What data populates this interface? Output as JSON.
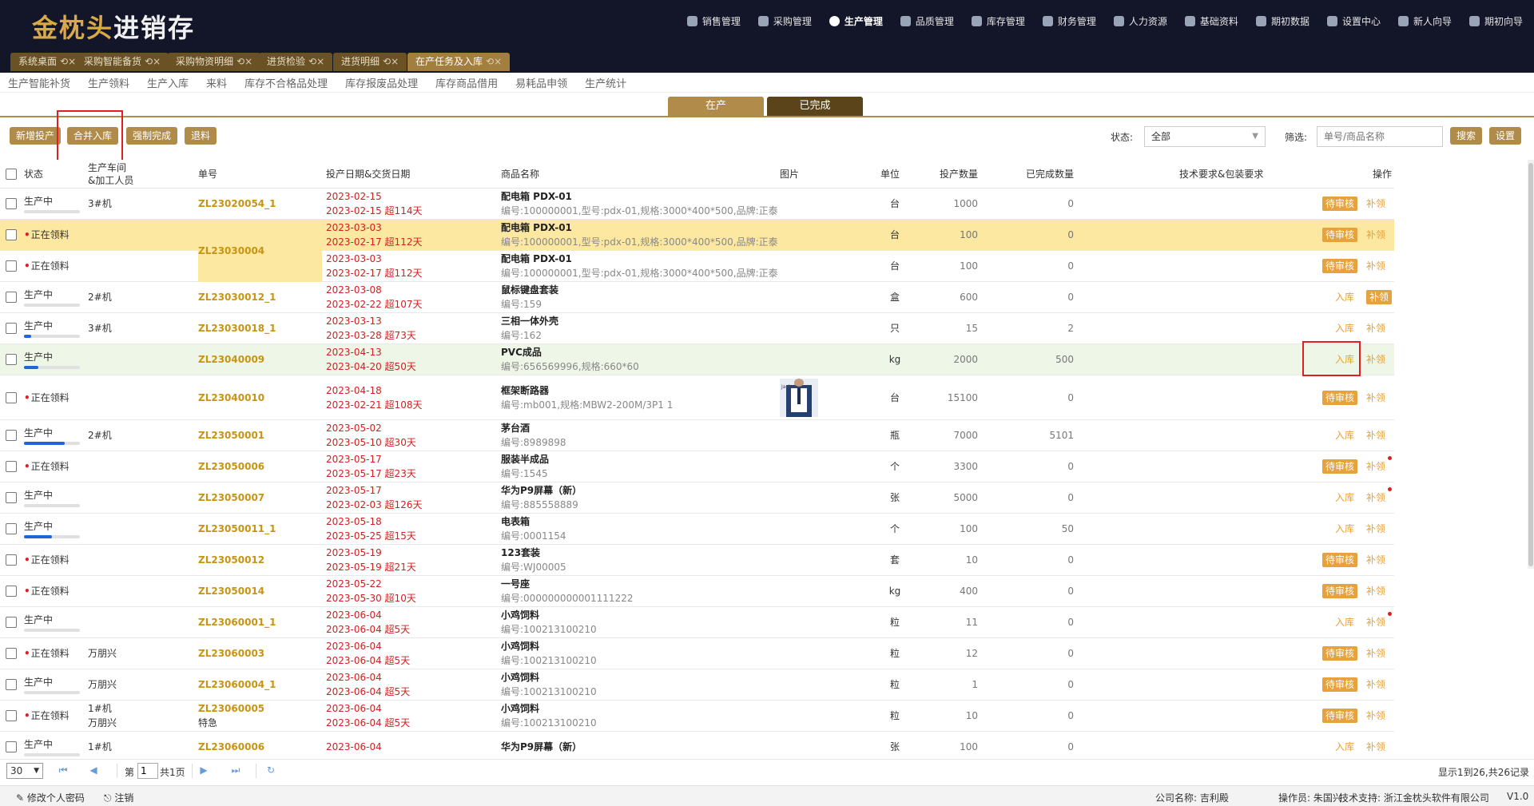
{
  "app": {
    "logo_a": "金枕头",
    "logo_b": "进销存"
  },
  "topnav": [
    {
      "label": "销售管理",
      "icon": "sales-icon"
    },
    {
      "label": "采购管理",
      "icon": "purchase-icon"
    },
    {
      "label": "生产管理",
      "icon": "production-icon"
    },
    {
      "label": "品质管理",
      "icon": "quality-icon"
    },
    {
      "label": "库存管理",
      "icon": "inventory-icon"
    },
    {
      "label": "财务管理",
      "icon": "finance-icon"
    },
    {
      "label": "人力资源",
      "icon": "hr-icon"
    },
    {
      "label": "基础资料",
      "icon": "basic-data-icon"
    },
    {
      "label": "期初数据",
      "icon": "opening-data-icon"
    },
    {
      "label": "设置中心",
      "icon": "settings-icon"
    },
    {
      "label": "新人向导",
      "icon": "newbie-guide-icon"
    },
    {
      "label": "期初向导",
      "icon": "opening-guide-icon"
    }
  ],
  "tabs": [
    {
      "label": "系统桌面"
    },
    {
      "label": "采购智能备货"
    },
    {
      "label": "采购物资明细"
    },
    {
      "label": "进货检验"
    },
    {
      "label": "进货明细"
    },
    {
      "label": "在产任务及入库"
    }
  ],
  "tab_close": "⟲×",
  "submenu": [
    "生产智能补货",
    "生产领料",
    "生产入库",
    "来料",
    "库存不合格品处理",
    "库存报废品处理",
    "库存商品借用",
    "易耗品申领",
    "生产统计"
  ],
  "segments": {
    "in_production": "在产",
    "completed": "已完成"
  },
  "toolbar": {
    "add": "新增投产",
    "merge": "合并入库",
    "force": "强制完成",
    "return": "退料",
    "status_label": "状态:",
    "status_value": "全部",
    "filter_label": "筛选:",
    "search_placeholder": "单号/商品名称",
    "search_btn": "搜索",
    "settings_btn": "设置"
  },
  "columns": {
    "status": "状态",
    "workshop_a": "生产车间",
    "workshop_b": "&加工人员",
    "order": "单号",
    "dates": "投产日期&交货日期",
    "product": "商品名称",
    "image": "图片",
    "unit": "单位",
    "qty": "投产数量",
    "done": "已完成数量",
    "req": "技术要求&包装要求",
    "op": "操作"
  },
  "rows": [
    {
      "status": "生产中",
      "progress": 0,
      "ws": "3#机",
      "ws2": "",
      "order": "ZL23020054_1",
      "d1": "2023-02-15",
      "d2": "2023-02-15 超114天",
      "pn": "配电箱 PDX-01",
      "pd": "编号:100000001,型号:pdx-01,规格:3000*400*500,品牌:正泰",
      "unit": "台",
      "qty": "1000",
      "done": "0",
      "op1": "待审核",
      "op1b": true,
      "op2": "补领",
      "op2b": false,
      "dot": false
    },
    {
      "status": "正在领料",
      "progress": null,
      "ws": "",
      "ws2": "",
      "order": "ZL23030004",
      "d1": "2023-03-03",
      "d2": "2023-02-17 超112天",
      "pn": "配电箱 PDX-01",
      "pd": "编号:100000001,型号:pdx-01,规格:3000*400*500,品牌:正泰",
      "unit": "台",
      "qty": "100",
      "done": "0",
      "op1": "待审核",
      "op1b": true,
      "op2": "补领",
      "op2b": false,
      "dot": false
    },
    {
      "status": "正在领料",
      "progress": null,
      "ws": "",
      "ws2": "",
      "order": "",
      "d1": "2023-03-03",
      "d2": "2023-02-17 超112天",
      "pn": "配电箱 PDX-01",
      "pd": "编号:100000001,型号:pdx-01,规格:3000*400*500,品牌:正泰",
      "unit": "台",
      "qty": "100",
      "done": "0",
      "op1": "待审核",
      "op1b": true,
      "op2": "补领",
      "op2b": false,
      "dot": false
    },
    {
      "status": "生产中",
      "progress": 0,
      "ws": "2#机",
      "ws2": "",
      "order": "ZL23030012_1",
      "d1": "2023-03-08",
      "d2": "2023-02-22 超107天",
      "pn": "鼠标键盘套装",
      "pd": "编号:159",
      "unit": "盒",
      "qty": "600",
      "done": "0",
      "op1": "入库",
      "op1b": false,
      "op2": "补领",
      "op2b": true,
      "dot": false
    },
    {
      "status": "生产中",
      "progress": 0.13,
      "ws": "3#机",
      "ws2": "",
      "order": "ZL23030018_1",
      "d1": "2023-03-13",
      "d2": "2023-03-28 超73天",
      "pn": "三相一体外壳",
      "pd": "编号:162",
      "unit": "只",
      "qty": "15",
      "done": "2",
      "op1": "入库",
      "op1b": false,
      "op2": "补领",
      "op2b": false,
      "dot": false
    },
    {
      "status": "生产中",
      "progress": 0.25,
      "ws": "",
      "ws2": "",
      "order": "ZL23040009",
      "d1": "2023-04-13",
      "d2": "2023-04-20 超50天",
      "pn": "PVC成品",
      "pd": "编号:656569996,规格:660*60",
      "unit": "kg",
      "qty": "2000",
      "done": "500",
      "op1": "入库",
      "op1b": false,
      "op2": "补领",
      "op2b": false,
      "dot": false
    },
    {
      "status": "正在领料",
      "progress": null,
      "ws": "",
      "ws2": "",
      "order": "ZL23040010",
      "d1": "2023-04-18",
      "d2": "2023-02-21 超108天",
      "pn": "框架断路器",
      "pd": "编号:mb001,规格:MBW2-200M/3P1 1",
      "unit": "台",
      "qty": "15100",
      "done": "0",
      "op1": "待审核",
      "op1b": true,
      "op2": "补领",
      "op2b": false,
      "dot": false,
      "img": true
    },
    {
      "status": "生产中",
      "progress": 0.73,
      "ws": "2#机",
      "ws2": "",
      "order": "ZL23050001",
      "d1": "2023-05-02",
      "d2": "2023-05-10 超30天",
      "pn": "茅台酒",
      "pd": "编号:8989898",
      "unit": "瓶",
      "qty": "7000",
      "done": "5101",
      "op1": "入库",
      "op1b": false,
      "op2": "补领",
      "op2b": false,
      "dot": false
    },
    {
      "status": "正在领料",
      "progress": null,
      "ws": "",
      "ws2": "",
      "order": "ZL23050006",
      "d1": "2023-05-17",
      "d2": "2023-05-17 超23天",
      "pn": "服装半成品",
      "pd": "编号:1545",
      "unit": "个",
      "qty": "3300",
      "done": "0",
      "op1": "待审核",
      "op1b": true,
      "op2": "补领",
      "op2b": false,
      "dot": true
    },
    {
      "status": "生产中",
      "progress": 0,
      "ws": "",
      "ws2": "",
      "order": "ZL23050007",
      "d1": "2023-05-17",
      "d2": "2023-02-03 超126天",
      "pn": "华为P9屏幕（新）",
      "pd": "编号:885558889",
      "unit": "张",
      "qty": "5000",
      "done": "0",
      "op1": "入库",
      "op1b": false,
      "op2": "补领",
      "op2b": false,
      "dot": true
    },
    {
      "status": "生产中",
      "progress": 0.5,
      "ws": "",
      "ws2": "",
      "order": "ZL23050011_1",
      "d1": "2023-05-18",
      "d2": "2023-05-25 超15天",
      "pn": "电表箱",
      "pd": "编号:0001154",
      "unit": "个",
      "qty": "100",
      "done": "50",
      "op1": "入库",
      "op1b": false,
      "op2": "补领",
      "op2b": false,
      "dot": false
    },
    {
      "status": "正在领料",
      "progress": null,
      "ws": "",
      "ws2": "",
      "order": "ZL23050012",
      "d1": "2023-05-19",
      "d2": "2023-05-19 超21天",
      "pn": "123套装",
      "pd": "编号:WJ00005",
      "unit": "套",
      "qty": "10",
      "done": "0",
      "op1": "待审核",
      "op1b": true,
      "op2": "补领",
      "op2b": false,
      "dot": false
    },
    {
      "status": "正在领料",
      "progress": null,
      "ws": "",
      "ws2": "",
      "order": "ZL23050014",
      "d1": "2023-05-22",
      "d2": "2023-05-30 超10天",
      "pn": "一号座",
      "pd": "编号:000000000001111222",
      "unit": "kg",
      "qty": "400",
      "done": "0",
      "op1": "待审核",
      "op1b": true,
      "op2": "补领",
      "op2b": false,
      "dot": false
    },
    {
      "status": "生产中",
      "progress": 0,
      "ws": "",
      "ws2": "",
      "order": "ZL23060001_1",
      "d1": "2023-06-04",
      "d2": "2023-06-04 超5天",
      "pn": "小鸡饲料",
      "pd": "编号:100213100210",
      "unit": "粒",
      "qty": "11",
      "done": "0",
      "op1": "入库",
      "op1b": false,
      "op2": "补领",
      "op2b": false,
      "dot": true
    },
    {
      "status": "正在领料",
      "progress": null,
      "ws": "万朋兴",
      "ws2": "",
      "order": "ZL23060003",
      "d1": "2023-06-04",
      "d2": "2023-06-04 超5天",
      "pn": "小鸡饲料",
      "pd": "编号:100213100210",
      "unit": "粒",
      "qty": "12",
      "done": "0",
      "op1": "待审核",
      "op1b": true,
      "op2": "补领",
      "op2b": false,
      "dot": false
    },
    {
      "status": "生产中",
      "progress": 0,
      "ws": "万朋兴",
      "ws2": "",
      "order": "ZL23060004_1",
      "d1": "2023-06-04",
      "d2": "2023-06-04 超5天",
      "pn": "小鸡饲料",
      "pd": "编号:100213100210",
      "unit": "粒",
      "qty": "1",
      "done": "0",
      "op1": "待审核",
      "op1b": true,
      "op2": "补领",
      "op2b": false,
      "dot": false
    },
    {
      "status": "正在领料",
      "progress": null,
      "ws": "1#机",
      "ws2": "万朋兴",
      "order": "ZL23060005",
      "order2": "特急",
      "d1": "2023-06-04",
      "d2": "2023-06-04 超5天",
      "pn": "小鸡饲料",
      "pd": "编号:100213100210",
      "unit": "粒",
      "qty": "10",
      "done": "0",
      "op1": "待审核",
      "op1b": true,
      "op2": "补领",
      "op2b": false,
      "dot": false
    },
    {
      "status": "生产中",
      "progress": 0,
      "ws": "1#机",
      "ws2": "",
      "order": "ZL23060006",
      "d1": "2023-06-04",
      "d2": "",
      "pn": "华为P9屏幕（新）",
      "pd": "",
      "unit": "张",
      "qty": "100",
      "done": "0",
      "op1": "入库",
      "op1b": false,
      "op2": "补领",
      "op2b": false,
      "dot": false
    }
  ],
  "image_thumb_label": "Jacket",
  "pager": {
    "size": "30",
    "page_prefix": "第",
    "page_value": "1",
    "page_total": "共1页",
    "info": "显示1到26,共26记录"
  },
  "footer": {
    "change_pwd": "修改个人密码",
    "logout": "注销",
    "company": "公司名称: 吉利殿",
    "operator": "操作员: 朱国兴",
    "support": "技术支持: 浙江金枕头软件有限公司",
    "version": "V1.0"
  }
}
